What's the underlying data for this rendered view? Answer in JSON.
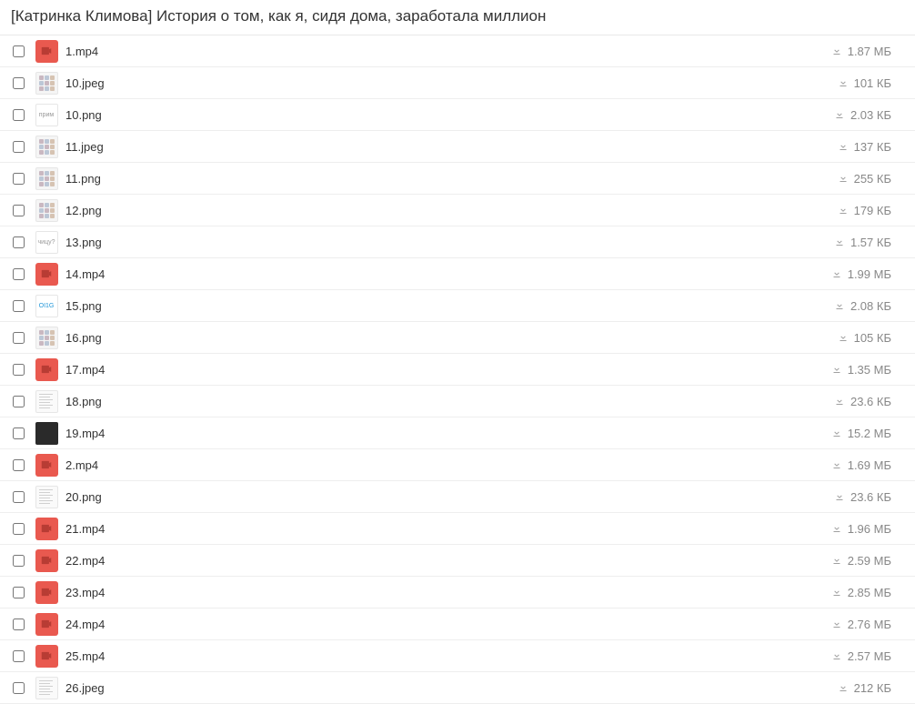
{
  "header": {
    "title": "[Катринка Климова] История о том, как я, сидя дома, заработала миллион"
  },
  "files": [
    {
      "name": "1.mp4",
      "size": "1.87 МБ",
      "thumb": "video"
    },
    {
      "name": "10.jpeg",
      "size": "101 КБ",
      "thumb": "image"
    },
    {
      "name": "10.png",
      "size": "2.03 КБ",
      "thumb": "text",
      "thumbLabel": "прим"
    },
    {
      "name": "11.jpeg",
      "size": "137 КБ",
      "thumb": "image"
    },
    {
      "name": "11.png",
      "size": "255 КБ",
      "thumb": "image"
    },
    {
      "name": "12.png",
      "size": "179 КБ",
      "thumb": "image"
    },
    {
      "name": "13.png",
      "size": "1.57 КБ",
      "thumb": "text",
      "thumbLabel": "чицу?"
    },
    {
      "name": "14.mp4",
      "size": "1.99 МБ",
      "thumb": "video"
    },
    {
      "name": "15.png",
      "size": "2.08 КБ",
      "thumb": "textblue",
      "thumbLabel": "OI1G"
    },
    {
      "name": "16.png",
      "size": "105 КБ",
      "thumb": "image"
    },
    {
      "name": "17.mp4",
      "size": "1.35 МБ",
      "thumb": "video"
    },
    {
      "name": "18.png",
      "size": "23.6 КБ",
      "thumb": "doc"
    },
    {
      "name": "19.mp4",
      "size": "15.2 МБ",
      "thumb": "dark"
    },
    {
      "name": "2.mp4",
      "size": "1.69 МБ",
      "thumb": "video"
    },
    {
      "name": "20.png",
      "size": "23.6 КБ",
      "thumb": "doc"
    },
    {
      "name": "21.mp4",
      "size": "1.96 МБ",
      "thumb": "video"
    },
    {
      "name": "22.mp4",
      "size": "2.59 МБ",
      "thumb": "video"
    },
    {
      "name": "23.mp4",
      "size": "2.85 МБ",
      "thumb": "video"
    },
    {
      "name": "24.mp4",
      "size": "2.76 МБ",
      "thumb": "video"
    },
    {
      "name": "25.mp4",
      "size": "2.57 МБ",
      "thumb": "video"
    },
    {
      "name": "26.jpeg",
      "size": "212 КБ",
      "thumb": "doc"
    }
  ]
}
